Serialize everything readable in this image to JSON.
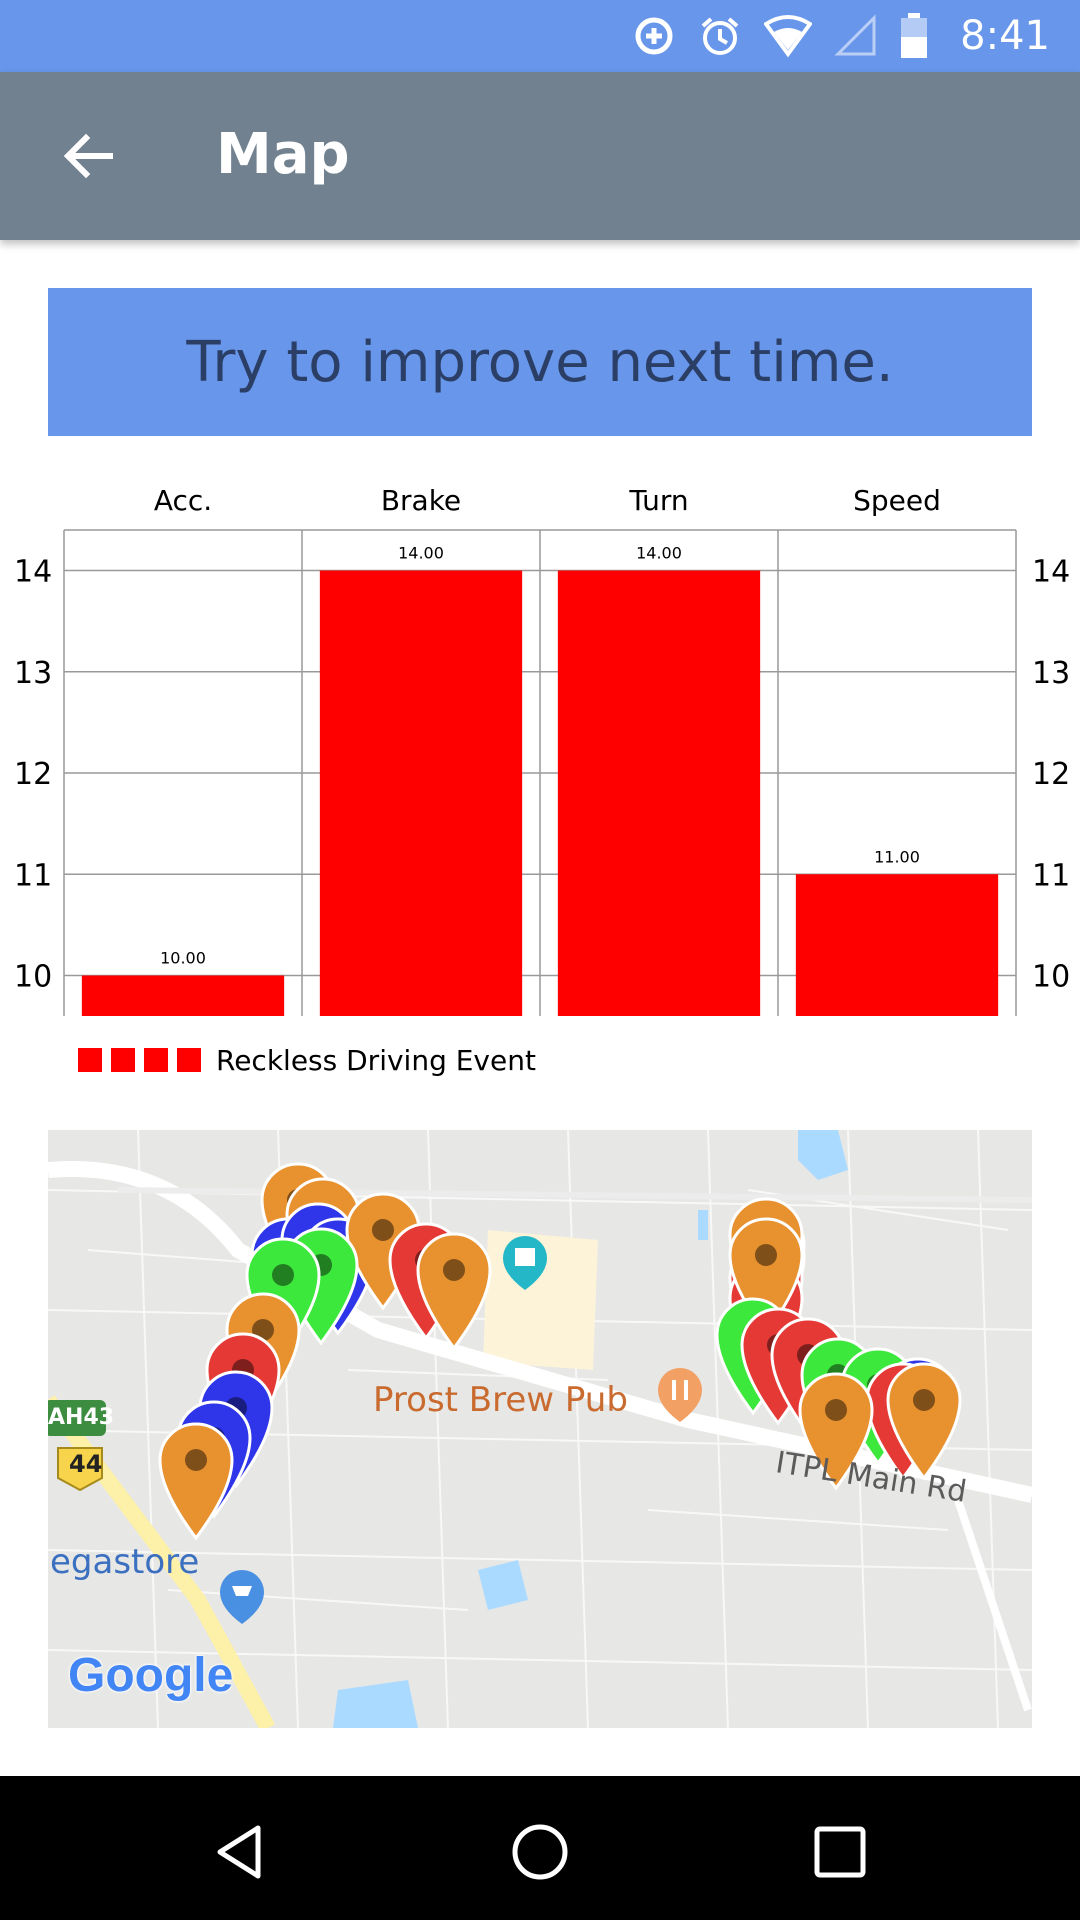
{
  "status_bar": {
    "time": "8:41",
    "icons": [
      "data-saver-icon",
      "alarm-icon",
      "wifi-icon",
      "cell-signal-icon",
      "battery-icon"
    ]
  },
  "app_bar": {
    "title": "Map",
    "back_icon": "arrow-back-icon"
  },
  "message": {
    "text": "Try to improve next time."
  },
  "chart_data": {
    "type": "bar",
    "categories": [
      "Acc.",
      "Brake",
      "Turn",
      "Speed"
    ],
    "series": [
      {
        "name": "Reckless Driving Event",
        "values": [
          10,
          14,
          14,
          11
        ],
        "color": "#ff0000"
      }
    ],
    "value_labels": [
      "10.00",
      "14.00",
      "14.00",
      "11.00"
    ],
    "y_ticks": [
      "10",
      "11",
      "12",
      "13",
      "14"
    ],
    "ylim": [
      9.6,
      14.4
    ],
    "grid": true,
    "axis_left_and_right": true,
    "category_labels_position": "top",
    "legend_position": "bottom-left"
  },
  "legend": {
    "label": "Reckless Driving Event",
    "swatch_color": "#ff0000"
  },
  "map": {
    "labels": {
      "pub": "Prost Brew Pub",
      "road": "ITPL Main Rd",
      "store": "egastore",
      "highway": "AH43",
      "route": "44",
      "google": "Google"
    },
    "marker_colors": {
      "orange": "#e8912f",
      "red": "#e53935",
      "blue": "#2f35e8",
      "green": "#3ce83c"
    }
  },
  "nav_bar": {
    "back": "nav-back-icon",
    "home": "nav-home-icon",
    "recents": "nav-recents-icon"
  }
}
